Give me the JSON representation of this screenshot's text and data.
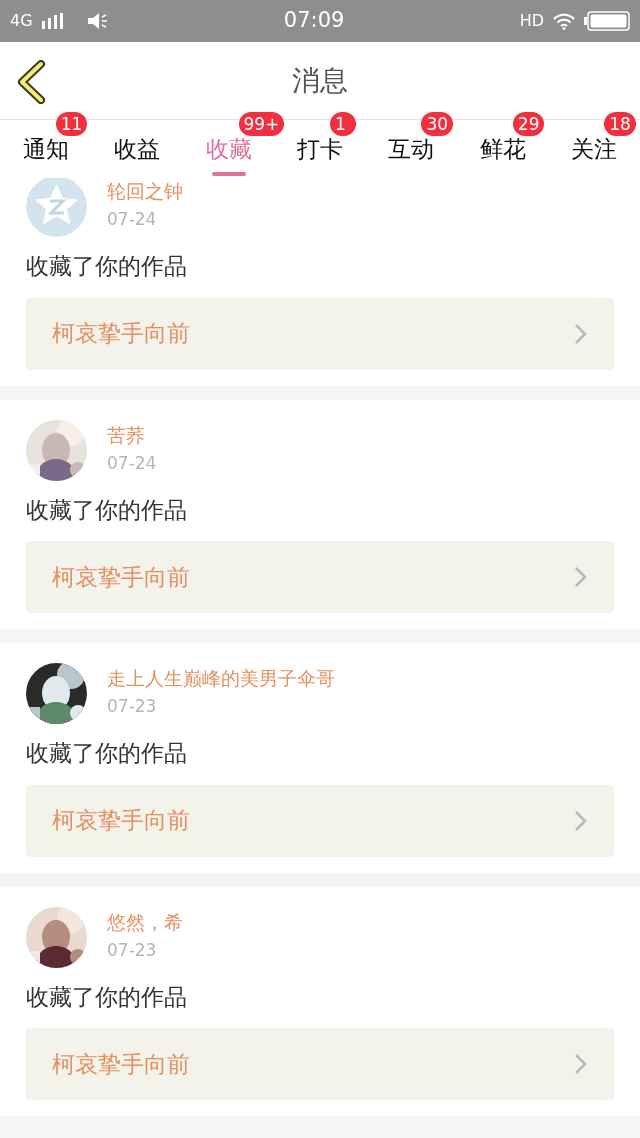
{
  "status_bar": {
    "network": "4G",
    "time": "07:09",
    "hd": "HD"
  },
  "header": {
    "title": "消息"
  },
  "tabs": [
    {
      "label": "通知",
      "badge": "11",
      "selected": false
    },
    {
      "label": "收益",
      "selected": false
    },
    {
      "label": "收藏",
      "badge": "99+",
      "selected": true
    },
    {
      "label": "打卡",
      "badge": "1",
      "selected": false
    },
    {
      "label": "互动",
      "badge": "30",
      "selected": false
    },
    {
      "label": "鲜花",
      "badge": "29",
      "selected": false
    },
    {
      "label": "关注",
      "badge": "18",
      "selected": false
    }
  ],
  "items": [
    {
      "avatar": {
        "kind": "default"
      },
      "user": "轮回之钟",
      "date": "07-24",
      "action": "收藏了你的作品",
      "work": "柯哀挚手向前"
    },
    {
      "user": "苦荞",
      "date": "07-24",
      "action": "收藏了你的作品",
      "work": "柯哀挚手向前"
    },
    {
      "user": "走上人生巅峰的美男子伞哥",
      "date": "07-23",
      "action": "收藏了你的作品",
      "work": "柯哀挚手向前"
    },
    {
      "user": "悠然，希",
      "date": "07-23",
      "action": "收藏了你的作品",
      "work": "柯哀挚手向前"
    }
  ]
}
